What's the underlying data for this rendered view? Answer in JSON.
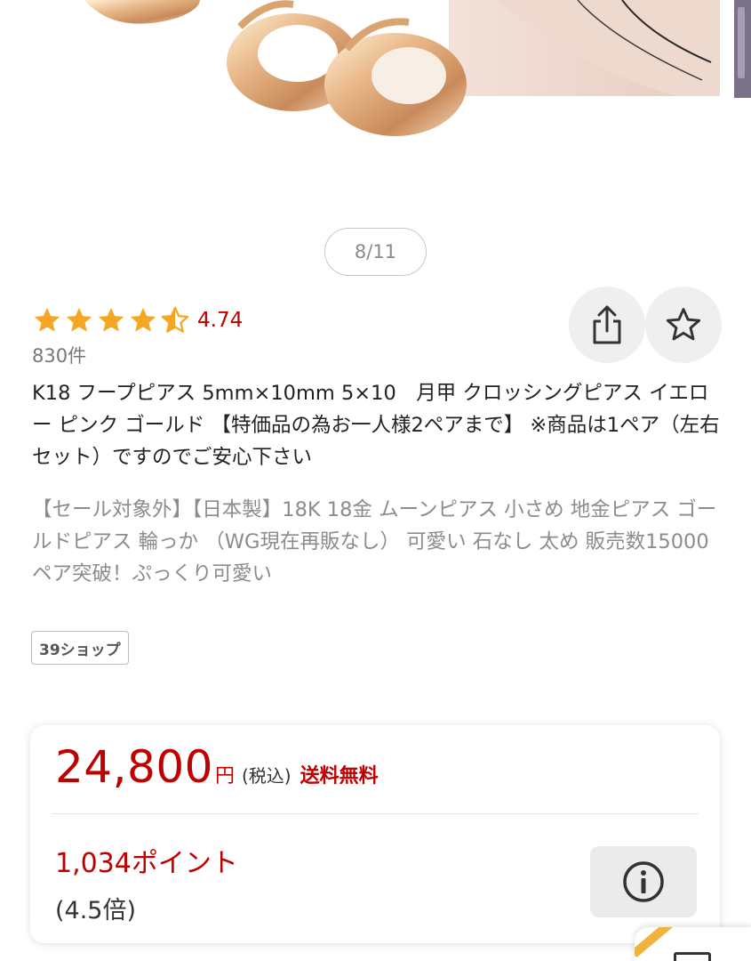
{
  "gallery": {
    "counter": "8/11"
  },
  "rating": {
    "stars": 4.5,
    "value": "4.74",
    "count": "830件",
    "star_color": "#f5a623"
  },
  "product": {
    "title": "K18 フープピアス 5mm×10mm 5×10　月甲 クロッシングピアス イエロー ピンク ゴールド 【特価品の為お一人様2ペアまで】 ※商品は1ペア（左右セット）ですのでご安心下さい",
    "subtitle": "【セール対象外】【日本製】18K 18金 ムーンピアス 小さめ 地金ピアス ゴールドピアス 輪っか （WG現在再販なし） 可愛い 石なし 太め 販売数15000ペア突破！ぷっくり可愛い",
    "shop_badge": "39ショップ"
  },
  "actions": {
    "share_icon": "share-icon",
    "favorite_icon": "star-outline-icon"
  },
  "price": {
    "amount": "24,800",
    "currency": "円",
    "tax_note": "(税込)",
    "shipping": "送料無料",
    "points": "1,034ポイント",
    "multiplier": "(4.5倍)",
    "info_icon": "info-icon"
  },
  "colors": {
    "accent_red": "#bf0000",
    "muted_text": "#8c8c8c"
  }
}
